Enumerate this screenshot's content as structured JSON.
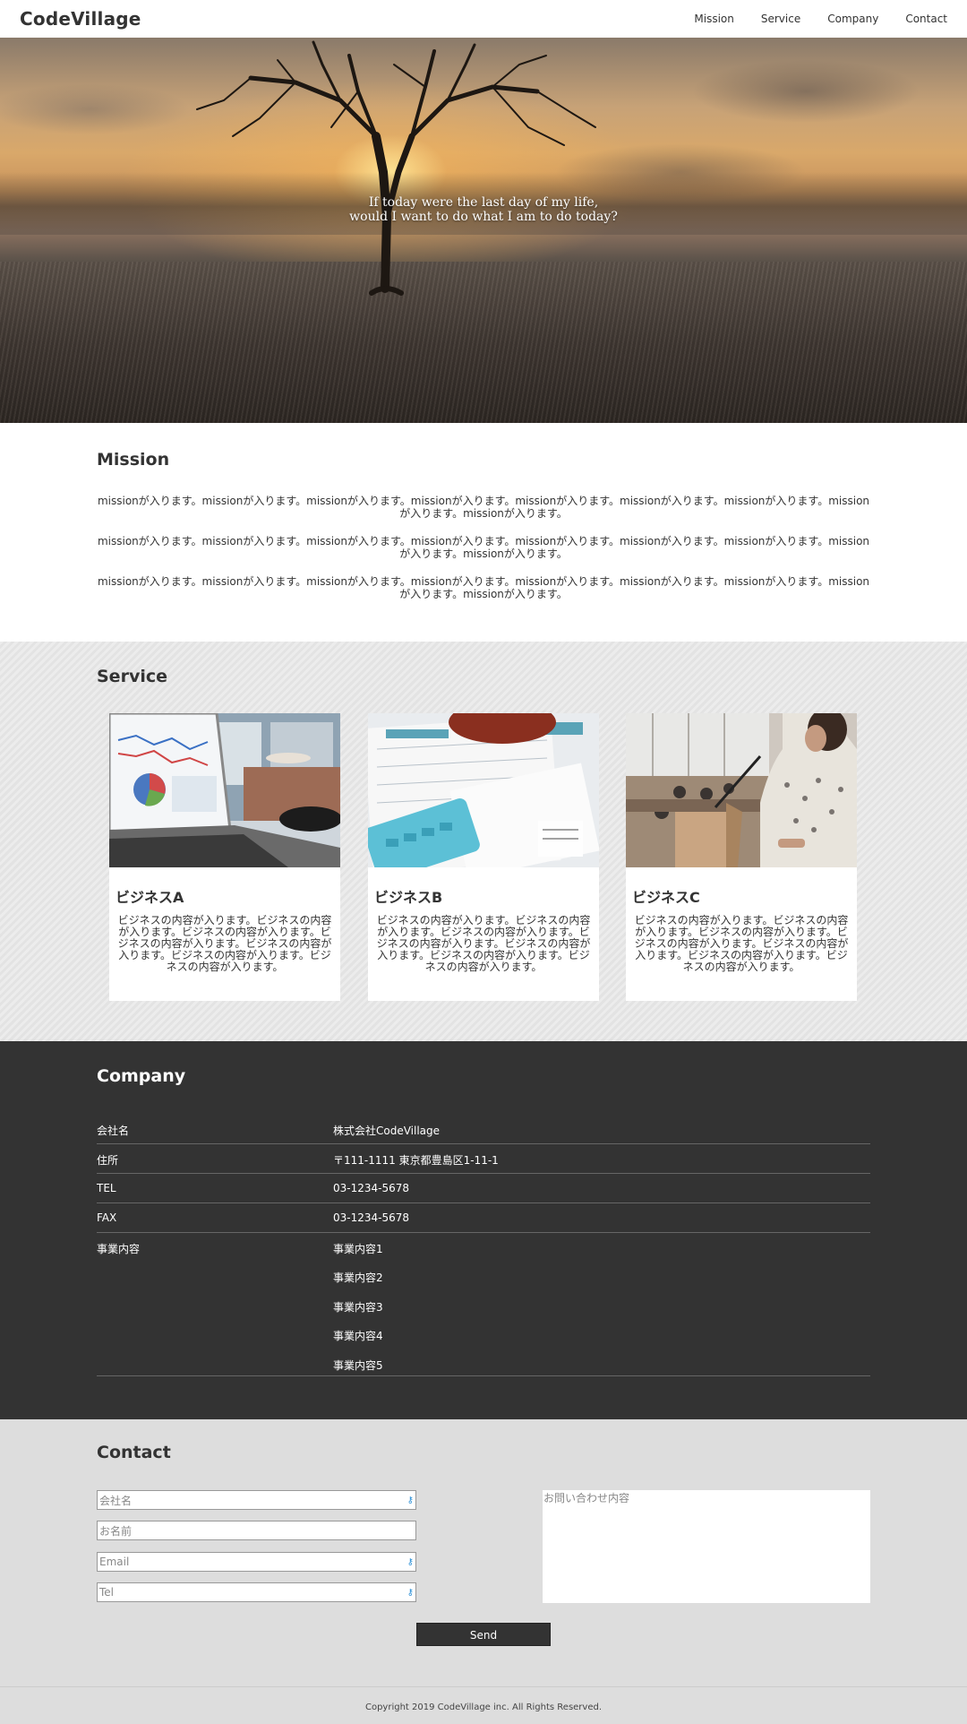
{
  "header": {
    "logo": "CodeVillage",
    "nav": [
      "Mission",
      "Service",
      "Company",
      "Contact"
    ]
  },
  "hero": {
    "line1": "If today were the last day of my life,",
    "line2": "would I want to do what I am to do today?"
  },
  "mission": {
    "title": "Mission",
    "paragraphs": [
      "missionが入ります。missionが入ります。missionが入ります。missionが入ります。missionが入ります。missionが入ります。missionが入ります。missionが入ります。missionが入ります。",
      "missionが入ります。missionが入ります。missionが入ります。missionが入ります。missionが入ります。missionが入ります。missionが入ります。missionが入ります。missionが入ります。",
      "missionが入ります。missionが入ります。missionが入ります。missionが入ります。missionが入ります。missionが入ります。missionが入ります。missionが入ります。missionが入ります。"
    ]
  },
  "service": {
    "title": "Service",
    "cards": [
      {
        "title": "ビジネスA",
        "text": "ビジネスの内容が入ります。ビジネスの内容が入ります。ビジネスの内容が入ります。ビジネスの内容が入ります。ビジネスの内容が入ります。ビジネスの内容が入ります。ビジネスの内容が入ります。"
      },
      {
        "title": "ビジネスB",
        "text": "ビジネスの内容が入ります。ビジネスの内容が入ります。ビジネスの内容が入ります。ビジネスの内容が入ります。ビジネスの内容が入ります。ビジネスの内容が入ります。ビジネスの内容が入ります。"
      },
      {
        "title": "ビジネスC",
        "text": "ビジネスの内容が入ります。ビジネスの内容が入ります。ビジネスの内容が入ります。ビジネスの内容が入ります。ビジネスの内容が入ります。ビジネスの内容が入ります。ビジネスの内容が入ります。"
      }
    ]
  },
  "company": {
    "title": "Company",
    "rows": [
      {
        "key": "会社名",
        "value": "株式会社CodeVillage"
      },
      {
        "key": "住所",
        "value": "〒111-1111 東京都豊島区1-11-1"
      },
      {
        "key": "TEL",
        "value": "03-1234-5678"
      },
      {
        "key": "FAX",
        "value": "03-1234-5678"
      }
    ],
    "business": {
      "key": "事業内容",
      "values": [
        "事業内容1",
        "事業内容2",
        "事業内容3",
        "事業内容4",
        "事業内容5"
      ]
    }
  },
  "contact": {
    "title": "Contact",
    "fields": [
      {
        "placeholder": "会社名",
        "icon": "key-icon"
      },
      {
        "placeholder": "お名前",
        "icon": ""
      },
      {
        "placeholder": "Email",
        "icon": "key-icon"
      },
      {
        "placeholder": "Tel",
        "icon": "key-icon"
      }
    ],
    "message_placeholder": "お問い合わせ内容",
    "send_label": "Send"
  },
  "footer": {
    "copyright": "Copyright 2019 CodeVillage inc. All Rights Reserved."
  },
  "colors": {
    "dark": "#333333",
    "contact_bg": "#dddddd",
    "key_icon": "#2b8fd6"
  }
}
